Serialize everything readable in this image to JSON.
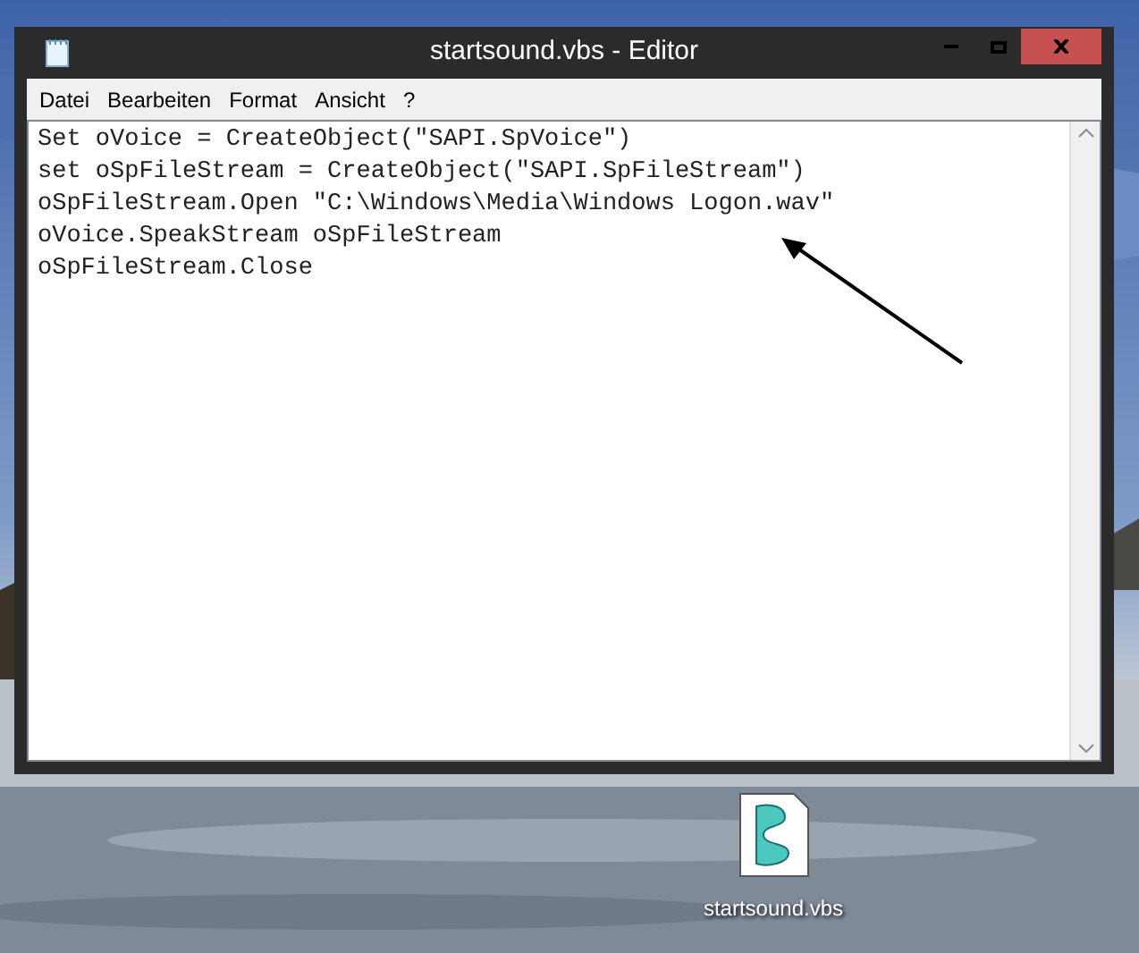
{
  "window": {
    "title": "startsound.vbs - Editor"
  },
  "menu": [
    "Datei",
    "Bearbeiten",
    "Format",
    "Ansicht",
    "?"
  ],
  "editor": {
    "lines": [
      "Set oVoice = CreateObject(\"SAPI.SpVoice\")",
      "set oSpFileStream = CreateObject(\"SAPI.SpFileStream\")",
      "oSpFileStream.Open \"C:\\Windows\\Media\\Windows Logon.wav\"",
      "oVoice.SpeakStream oSpFileStream",
      "oSpFileStream.Close"
    ]
  },
  "desktop_icons": [
    {
      "label": "startsound.vbs"
    }
  ]
}
